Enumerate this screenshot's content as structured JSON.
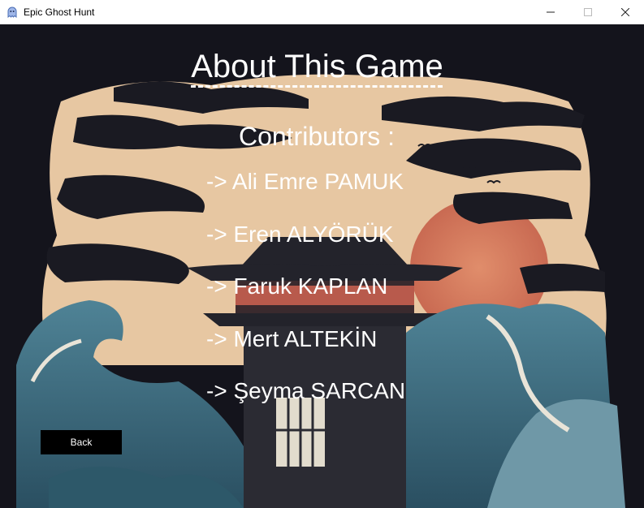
{
  "window": {
    "title": "Epic Ghost Hunt",
    "app_icon": "ghost-app-icon",
    "controls": [
      "minimize-icon",
      "maximize-icon",
      "close-icon"
    ]
  },
  "about": {
    "title": "About This Game",
    "contributors_heading": "Contributors :",
    "contributors": [
      "-> Ali Emre PAMUK",
      "-> Eren ALYÖRÜK",
      "-> Faruk KAPLAN",
      "-> Mert ALTEKİN",
      "-> Şeyma SARCAN"
    ]
  },
  "back_button": {
    "label": "Back"
  },
  "colors": {
    "sky": "#e7c7a2",
    "sun": "#d98062",
    "wave": "#3f6f82",
    "dark": "#15151d",
    "text": "#ffffff"
  }
}
